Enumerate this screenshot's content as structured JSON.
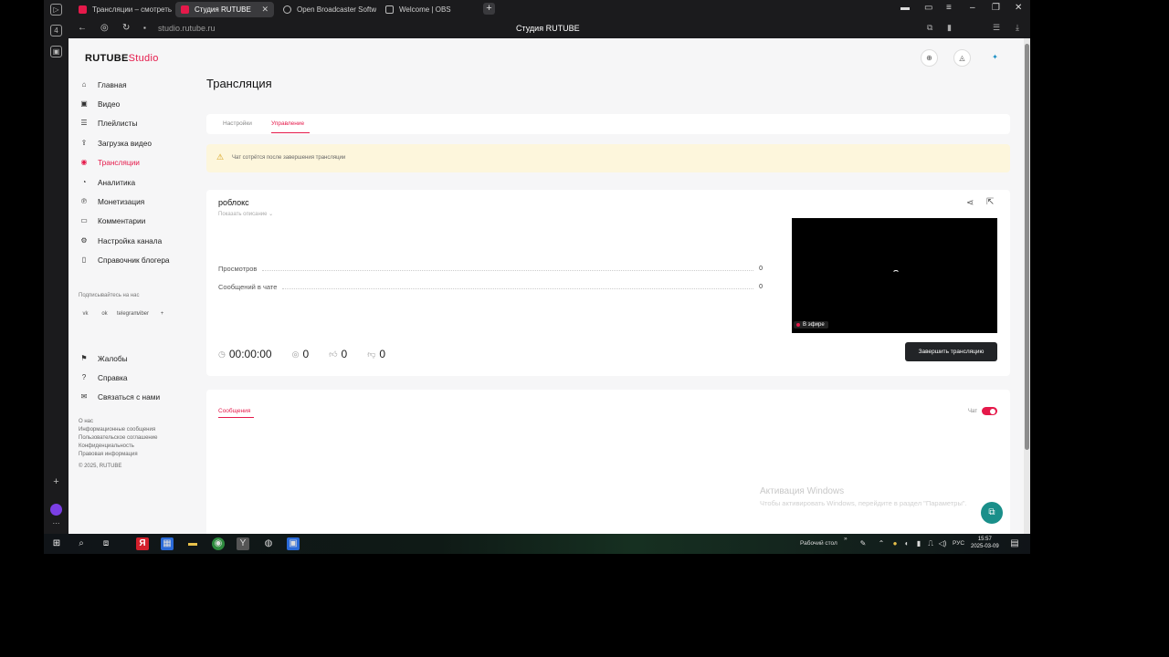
{
  "browser": {
    "tabs": [
      {
        "label": "Трансляции – смотреть о"
      },
      {
        "label": "Студия RUTUBE"
      },
      {
        "label": "Open Broadcaster Softwa"
      },
      {
        "label": "Welcome | OBS"
      }
    ],
    "url": "studio.rutube.ru",
    "page_title": "Студия RUTUBE",
    "side_badge": "4"
  },
  "logo": {
    "brand": "RUTUBE",
    "product": "Studio"
  },
  "sidebar": {
    "items": [
      {
        "label": "Главная",
        "icon": "home-icon"
      },
      {
        "label": "Видео",
        "icon": "video-icon"
      },
      {
        "label": "Плейлисты",
        "icon": "playlist-icon"
      },
      {
        "label": "Загрузка видео",
        "icon": "upload-icon"
      },
      {
        "label": "Трансляции",
        "icon": "broadcast-icon",
        "active": true
      },
      {
        "label": "Аналитика",
        "icon": "analytics-icon"
      },
      {
        "label": "Монетизация",
        "icon": "monetization-icon"
      },
      {
        "label": "Комментарии",
        "icon": "comments-icon"
      },
      {
        "label": "Настройка канала",
        "icon": "settings-icon"
      },
      {
        "label": "Справочник блогера",
        "icon": "book-icon"
      }
    ],
    "subscribe_label": "Подписывайтесь на нас",
    "socials": [
      "vk",
      "ok",
      "telegram",
      "viber",
      "+"
    ],
    "secondary_items": [
      {
        "label": "Жалобы",
        "icon": "flag-icon"
      },
      {
        "label": "Справка",
        "icon": "help-icon"
      },
      {
        "label": "Связаться с нами",
        "icon": "mail-icon"
      }
    ],
    "footer_links": [
      "О нас",
      "Информационные сообщения",
      "Пользовательское соглашение",
      "Конфиденциальность",
      "Правовая информация",
      "© 2025, RUTUBE"
    ]
  },
  "main": {
    "title": "Трансляция",
    "tabs": [
      {
        "label": "Настройки"
      },
      {
        "label": "Управление",
        "active": true
      }
    ],
    "warning": "Чат сотрётся после завершения трансляции",
    "stream": {
      "title": "роблокс",
      "show_description": "Показать описание ⌄",
      "stats": [
        {
          "label": "Просмотров",
          "value": "0"
        },
        {
          "label": "Сообщений в чате",
          "value": "0"
        }
      ],
      "live_badge": "В эфире",
      "timer": "00:00:00",
      "viewers": "0",
      "likes": "0",
      "dislikes": "0",
      "end_button": "Завершить трансляцию"
    },
    "chat": {
      "tab": "Сообщения",
      "toggle_label": "Чат",
      "enabled": true
    }
  },
  "watermark": {
    "line1": "Активация Windows",
    "line2": "Чтобы активировать Windows, перейдите в раздел \"Параметры\"."
  },
  "taskbar": {
    "desktop_label": "Рабочий стол",
    "lang": "РУС",
    "time": "15:57",
    "date": "2025-03-09"
  },
  "colors": {
    "accent": "#e5194a",
    "dark_button": "#222427",
    "help": "#1a8f8a"
  }
}
